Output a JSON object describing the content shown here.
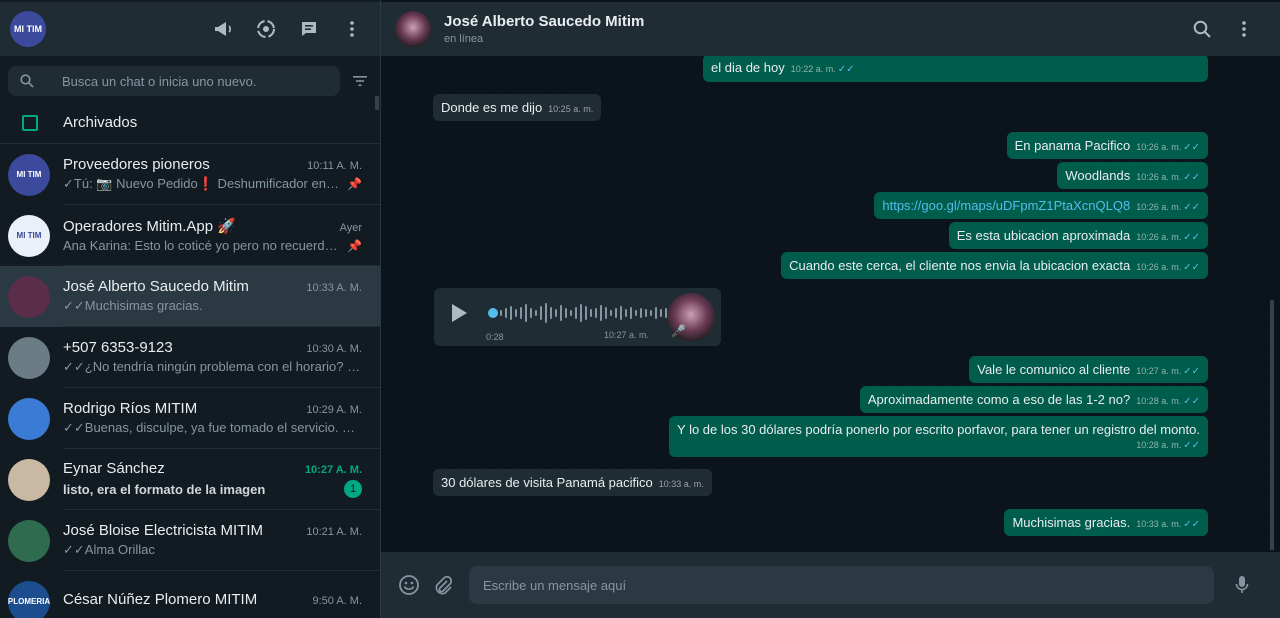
{
  "colors": {
    "accent": "#00a884",
    "outgoing": "#005c4b",
    "incoming": "#202c33",
    "link": "#53bdeb"
  },
  "sidebar": {
    "profile_initials": "MI TIM",
    "icons": [
      "megaphone-icon",
      "status-icon",
      "new-chat-icon",
      "menu-icon"
    ],
    "search_placeholder": "Busca un chat o inicia uno nuevo.",
    "archived_label": "Archivados",
    "chats": [
      {
        "name": "Proveedores pioneros",
        "time": "10:11 A. M.",
        "preview": "✓Tú: 📷 Nuevo Pedido❗ Deshumificador enciend…",
        "pinned": true,
        "avatar_text": "MI TIM",
        "avatar_color": "#3b4a9c"
      },
      {
        "name": "Operadores Mitim.App 🚀",
        "time": "Ayer",
        "preview": "Ana Karina: Esto lo coticé yo pero no recuerdo con …",
        "pinned": true,
        "avatar_text": "MI TIM",
        "avatar_color": "#e9f0f7"
      },
      {
        "name": "José Alberto Saucedo Mitim",
        "time": "10:33 A. M.",
        "preview": "✓✓Muchisimas gracias.",
        "active": true,
        "avatar_color": "#5a2e48"
      },
      {
        "name": "+507 6353-9123",
        "time": "10:30 A. M.",
        "preview": "✓✓¿No tendría ningún problema con el horario? me c…",
        "avatar_color": "#6b7c85"
      },
      {
        "name": "Rodrigo Ríos MITIM",
        "time": "10:29 A. M.",
        "preview": "✓✓Buenas, disculpe, ya fue tomado el servicio. Muchís…",
        "avatar_color": "#3a7bd5"
      },
      {
        "name": "Eynar Sánchez",
        "time": "10:27 A. M.",
        "preview": "listo, era el formato de la imagen",
        "unread": "1",
        "avatar_color": "#c9b8a2"
      },
      {
        "name": "José Bloise Electricista MITIM",
        "time": "10:21 A. M.",
        "preview": "✓✓Alma Orillac",
        "avatar_color": "#2f6b4f"
      },
      {
        "name": "César Núñez Plomero MITIM",
        "time": "9:50 A. M.",
        "preview": "",
        "avatar_text": "PLOMERIA",
        "avatar_color": "#1b4d8f"
      }
    ]
  },
  "chat": {
    "contact_name": "José Alberto Saucedo Mitim",
    "contact_status": "en línea",
    "header_icons": [
      "search-icon",
      "menu-icon"
    ],
    "messages": [
      {
        "dir": "out",
        "text": "el dia de hoy",
        "time": "10:22 a. m."
      },
      {
        "dir": "in",
        "text": "Donde es me dijo",
        "time": "10:25 a. m."
      },
      {
        "dir": "out",
        "text": "En panama Pacifico",
        "time": "10:26 a. m."
      },
      {
        "dir": "out",
        "text": "Woodlands",
        "time": "10:26 a. m."
      },
      {
        "dir": "out",
        "text": "https://goo.gl/maps/uDFpmZ1PtaXcnQLQ8",
        "time": "10:26 a. m.",
        "link": true
      },
      {
        "dir": "out",
        "text": "Es esta ubicacion aproximada",
        "time": "10:26 a. m."
      },
      {
        "dir": "out",
        "text": "Cuando este cerca, el cliente nos envia la ubicacion exacta",
        "time": "10:26 a. m."
      },
      {
        "dir": "out",
        "text": "Vale le comunico al cliente",
        "time": "10:27 a. m."
      },
      {
        "dir": "out",
        "text": "Aproximadamente como a eso de las 1-2 no?",
        "time": "10:28 a. m."
      },
      {
        "dir": "out",
        "text": "Y lo de los 30 dólares podría ponerlo por escrito porfavor, para tener un registro del monto.",
        "time": "10:28 a. m."
      },
      {
        "dir": "in",
        "text": "30 dólares de visita Panamá pacifico",
        "time": "10:33 a. m."
      },
      {
        "dir": "out",
        "text": "Muchisimas gracias.",
        "time": "10:33 a. m."
      }
    ],
    "voice_note": {
      "duration": "0:28",
      "time": "10:27 a. m.",
      "progress": 0.0
    }
  },
  "composer": {
    "placeholder": "Escribe un mensaje aquí"
  }
}
